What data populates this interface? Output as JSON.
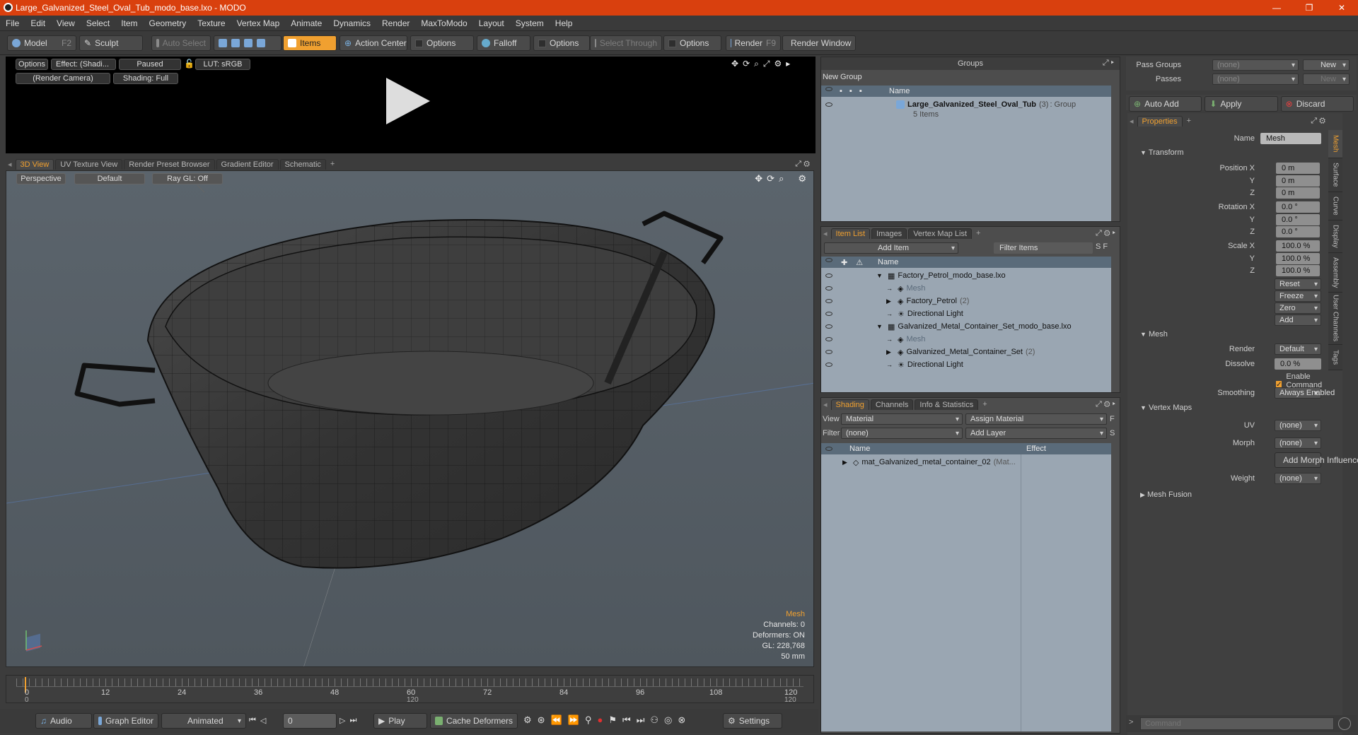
{
  "window": {
    "title": "Large_Galvanized_Steel_Oval_Tub_modo_base.lxo - MODO"
  },
  "menu": [
    "File",
    "Edit",
    "View",
    "Select",
    "Item",
    "Geometry",
    "Texture",
    "Vertex Map",
    "Animate",
    "Dynamics",
    "Render",
    "MaxToModo",
    "Layout",
    "System",
    "Help"
  ],
  "toolbar": {
    "model": "Model",
    "model_key": "F2",
    "sculpt": "Sculpt",
    "auto_select": "Auto Select",
    "items": "Items",
    "action_center": "Action Center",
    "options1": "Options",
    "falloff": "Falloff",
    "options2": "Options",
    "select_through": "Select Through",
    "options3": "Options",
    "render": "Render",
    "render_key": "F9",
    "render_window": "Render Window"
  },
  "preview": {
    "options": "Options",
    "effect": "Effect: (Shadi...",
    "paused": "Paused",
    "lut": "LUT: sRGB",
    "camera": "(Render Camera)",
    "shading": "Shading: Full"
  },
  "viewport_tabs": [
    "3D View",
    "UV Texture View",
    "Render Preset Browser",
    "Gradient Editor",
    "Schematic"
  ],
  "viewport": {
    "perspective": "Perspective",
    "default": "Default",
    "raygl": "Ray GL: Off",
    "info_title": "Mesh",
    "channels": "Channels: 0",
    "deformers": "Deformers: ON",
    "gl": "GL: 228,768",
    "focal": "50 mm"
  },
  "timeline": {
    "ticks": [
      "0",
      "12",
      "24",
      "36",
      "48",
      "60",
      "72",
      "84",
      "96",
      "108",
      "120"
    ],
    "start": "0",
    "mid": "120",
    "end": "120"
  },
  "bottombar": {
    "audio": "Audio",
    "graph_editor": "Graph Editor",
    "animated": "Animated",
    "frame": "0",
    "play": "Play",
    "cache": "Cache Deformers",
    "settings": "Settings"
  },
  "groups": {
    "title": "Groups",
    "new_group": "New Group",
    "col_name": "Name",
    "group_name": "Large_Galvanized_Steel_Oval_Tub",
    "group_count": "(3)",
    "group_type": ": Group",
    "group_items": "5 Items"
  },
  "itemlist": {
    "tabs": [
      "Item List",
      "Images",
      "Vertex Map List"
    ],
    "add_item": "Add Item",
    "filter": "Filter Items",
    "col_name": "Name",
    "rows": [
      {
        "label": "Factory_Petrol_modo_base.lxo",
        "indent": 0,
        "arrow": "▼"
      },
      {
        "label": "Mesh",
        "indent": 1,
        "arrow": "",
        "dim": true
      },
      {
        "label": "Factory_Petrol",
        "suffix": "(2)",
        "indent": 1,
        "arrow": "▶"
      },
      {
        "label": "Directional Light",
        "indent": 1,
        "arrow": ""
      },
      {
        "label": "Galvanized_Metal_Container_Set_modo_base.lxo",
        "indent": 0,
        "arrow": "▼"
      },
      {
        "label": "Mesh",
        "indent": 1,
        "arrow": "",
        "dim": true
      },
      {
        "label": "Galvanized_Metal_Container_Set",
        "suffix": "(2)",
        "indent": 1,
        "arrow": "▶"
      },
      {
        "label": "Directional Light",
        "indent": 1,
        "arrow": ""
      }
    ]
  },
  "shading": {
    "tabs": [
      "Shading",
      "Channels",
      "Info & Statistics"
    ],
    "view_label": "View",
    "view_value": "Material",
    "assign": "Assign Material",
    "filter_label": "Filter",
    "filter_value": "(none)",
    "add_layer": "Add Layer",
    "col_name": "Name",
    "col_effect": "Effect",
    "material": "mat_Galvanized_metal_container_02",
    "material_suffix": "(Mat..."
  },
  "passes": {
    "pass_groups": "Pass Groups",
    "passes": "Passes",
    "none": "(none)",
    "new": "New",
    "auto_add": "Auto Add",
    "apply": "Apply",
    "discard": "Discard"
  },
  "properties": {
    "tab": "Properties",
    "name_label": "Name",
    "name_value": "Mesh",
    "transform": "Transform",
    "position_label": "Position X",
    "rotation_label": "Rotation X",
    "scale_label": "Scale X",
    "y": "Y",
    "z": "Z",
    "pos": [
      "0 m",
      "0 m",
      "0 m"
    ],
    "rot": [
      "0.0 °",
      "0.0 °",
      "0.0 °"
    ],
    "scale": [
      "100.0 %",
      "100.0 %",
      "100.0 %"
    ],
    "reset": "Reset",
    "freeze": "Freeze",
    "zero": "Zero",
    "add": "Add",
    "mesh": "Mesh",
    "render_label": "Render",
    "render_value": "Default",
    "dissolve_label": "Dissolve",
    "dissolve_value": "0.0 %",
    "enable_cmd": "Enable Command Regions",
    "smoothing_label": "Smoothing",
    "smoothing_value": "Always Enabled",
    "vertex_maps": "Vertex Maps",
    "uv_label": "UV",
    "uv_value": "(none)",
    "morph_label": "Morph",
    "morph_value": "(none)",
    "add_morph": "Add Morph Influence",
    "weight_label": "Weight",
    "weight_value": "(none)",
    "mesh_fusion": "Mesh Fusion",
    "side_tabs": [
      "Mesh",
      "Surface",
      "Curve",
      "Display",
      "Assembly",
      "User Channels",
      "Tags"
    ]
  },
  "command": {
    "placeholder": "Command"
  },
  "colors": {
    "accent": "#f0a030",
    "title_bg": "#d9400e",
    "list_bg": "#9aa6b2"
  }
}
